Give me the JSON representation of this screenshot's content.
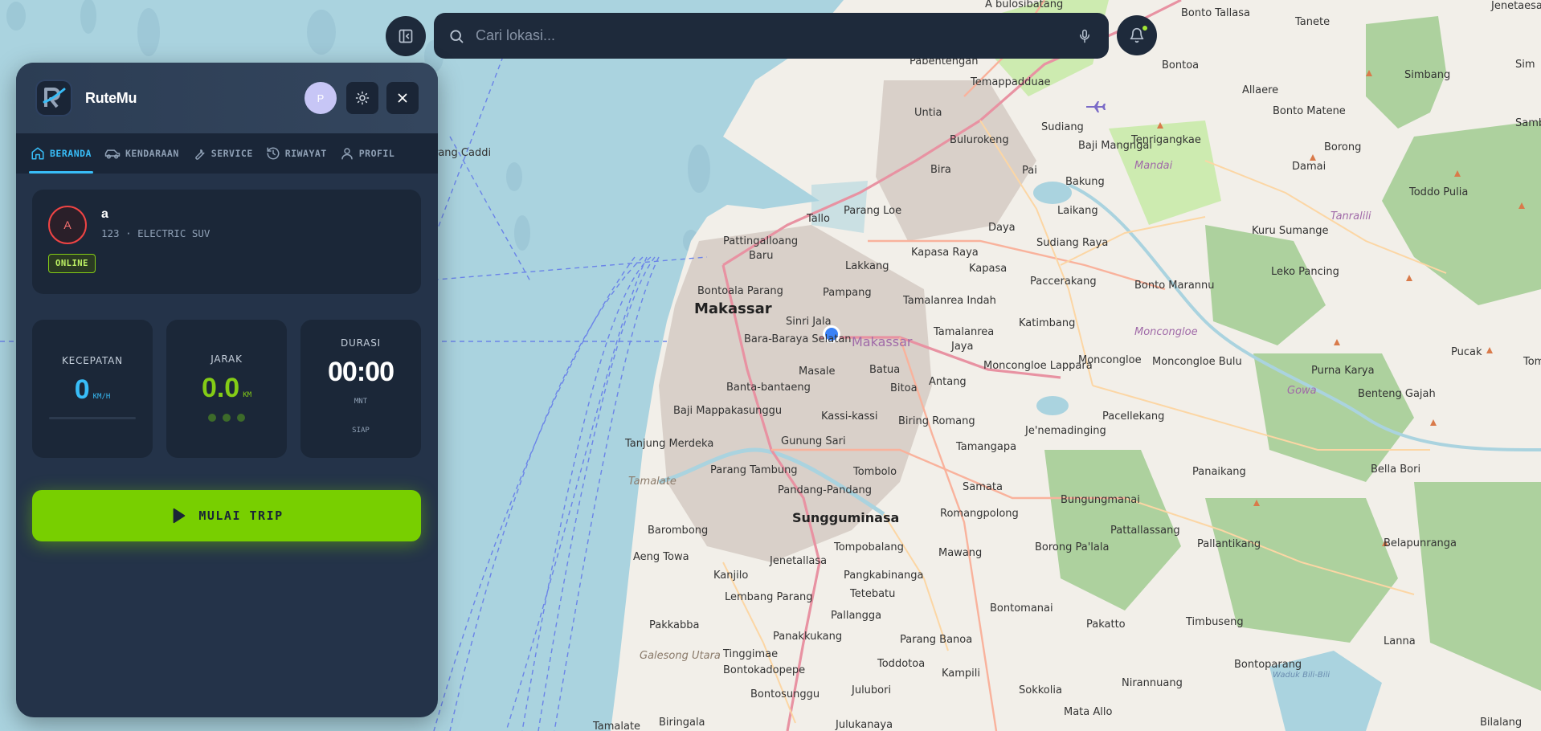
{
  "search": {
    "placeholder": "Cari lokasi..."
  },
  "app": {
    "name": "RuteMu",
    "user_initial": "P"
  },
  "tabs": [
    {
      "label": "BERANDA",
      "icon": "home-icon",
      "active": true
    },
    {
      "label": "KENDARAAN",
      "icon": "car-icon",
      "active": false
    },
    {
      "label": "SERVICE",
      "icon": "wrench-icon",
      "active": false
    },
    {
      "label": "RIWAYAT",
      "icon": "history-icon",
      "active": false
    },
    {
      "label": "PROFIL",
      "icon": "user-icon",
      "active": false
    }
  ],
  "vehicle": {
    "initial": "A",
    "name": "a",
    "subtitle": "123 · ELECTRIC SUV",
    "status": "ONLINE"
  },
  "stats": {
    "speed": {
      "title": "KECEPATAN",
      "value": "0",
      "unit": "KM/H"
    },
    "distance": {
      "title": "JARAK",
      "value": "0.0",
      "unit": "KM"
    },
    "duration": {
      "title": "DURASI",
      "value": "00:00",
      "unit": "MNT",
      "status": "SIAP"
    }
  },
  "start_button": {
    "label": "MULAI TRIP"
  },
  "colors": {
    "accent_blue": "#38bdf8",
    "accent_green": "#78cf00",
    "panel": "#243349",
    "danger": "#ef4444"
  },
  "map": {
    "labels": {
      "makassar_big": "Makassar",
      "makassar_area": "Makassar",
      "sungguminasa": "Sungguminasa",
      "untia": "Untia",
      "bira": "Bira",
      "bulurokeng": "Bulurokeng",
      "sudiang": "Sudiang",
      "sudiang_raya": "Sudiang Raya",
      "baji_mangngai": "Baji Mangngai",
      "bakung": "Bakung",
      "laikang": "Laikang",
      "daya": "Daya",
      "pai": "Pai",
      "tallo": "Tallo",
      "parang_loe": "Parang Loe",
      "pattingalloang": "Pattingalloang",
      "baru": "Baru",
      "lakkang": "Lakkang",
      "kapasa_raya": "Kapasa Raya",
      "kapasa": "Kapasa",
      "paccerakang": "Paccerakang",
      "bontoala_parang": "Bontoala Parang",
      "pampang": "Pampang",
      "tamalanrea_indah": "Tamalanrea Indah",
      "tamalanrea": "Tamalanrea",
      "tamalanrea_jaya": "Jaya",
      "katimbang": "Katimbang",
      "sinri_jala": "Sinri Jala",
      "bara_baraya": "Bara-Baraya Selatan",
      "masale": "Masale",
      "batua": "Batua",
      "bitoa": "Bitoa",
      "antang": "Antang",
      "moncongloe_lappara": "Moncongloe Lappara",
      "moncongloe": "Moncongloe",
      "banta_bantaeng": "Banta-bantaeng",
      "baji_mappakasunggu": "Baji Mappakasunggu",
      "kassi_kassi": "Kassi-kassi",
      "biring_romang": "Biring Romang",
      "tanjung_merdeka": "Tanjung Merdeka",
      "gunung_sari": "Gunung Sari",
      "tamangapa": "Tamangapa",
      "jenemadinging": "Je'nemadinging",
      "parang_tambung": "Parang Tambung",
      "tombolo": "Tombolo",
      "pandang": "Pandang-Pandang",
      "samata": "Samata",
      "romangpolong": "Romangpolong",
      "barombong": "Barombong",
      "tompobalang": "Tompobalang",
      "mawang": "Mawang",
      "aeng_towa": "Aeng Towa",
      "jenetallasa": "Jenetallasa",
      "kanjilo": "Kanjilo",
      "pangkabinanga": "Pangkabinanga",
      "lembang_parang": "Lembang Parang",
      "tetebatu": "Tetebatu",
      "pallangga": "Pallangga",
      "pakkabba": "Pakkabba",
      "panakkukang": "Panakkukang",
      "parang_banoa": "Parang Banoa",
      "tinggimae": "Tinggimae",
      "toddotoa": "Toddotoa",
      "bontokadopepe": "Bontokadopepe",
      "kampili": "Kampili",
      "julubori": "Julubori",
      "bontosunggu": "Bontosunggu",
      "sokkolia": "Sokkolia",
      "mata_allo": "Mata Allo",
      "biringala": "Biringala",
      "julukanaya": "Julukanaya",
      "tamalate": "Tamalate",
      "galesong_utara": "Galesong Utara",
      "tamalate_water": "Tamalate",
      "pabentengan": "Pabentengan",
      "temappadduae": "Temappadduae",
      "bontoa": "Bontoa",
      "bonto_tallasa": "Bonto Tallasa",
      "tanete": "Tanete",
      "jenetaesa": "Jenetaesa",
      "a_bulosibatang": "A bulosibatang",
      "allaere": "Allaere",
      "bonto_matene": "Bonto Matene",
      "simbang": "Simbang",
      "tenrigangkae": "Tenrigangkae",
      "mandai": "Mandai",
      "borong": "Borong",
      "damai": "Damai",
      "toddo_pulia": "Toddo Pulia",
      "tanralili": "Tanralili",
      "kuru_sumange": "Kuru Sumange",
      "leko_pancing": "Leko Pancing",
      "bonto_marannu": "Bonto Marannu",
      "moncongloe_purple": "Moncongloe",
      "moncongloe_bulu": "Moncongloe Bulu",
      "pucak": "Pucak",
      "purna_karya": "Purna Karya",
      "gowa": "Gowa",
      "benteng_gajah": "Benteng Gajah",
      "pacellekang": "Pacellekang",
      "panaikang": "Panaikang",
      "bella_bori": "Bella Bori",
      "bungungmanai": "Bungungmanai",
      "pattallassang": "Pattallassang",
      "borong_pallala": "Borong Pa'lala",
      "pallantikang": "Pallantikang",
      "belapunranga": "Belapunranga",
      "bontomanai": "Bontomanai",
      "pakatto": "Pakatto",
      "timbuseng": "Timbuseng",
      "lanna": "Lanna",
      "bontoparang": "Bontoparang",
      "nirannuang": "Nirannuang",
      "waduk": "Waduk Bili-Bili",
      "bilalang": "Bilalang",
      "gang_caddi": "rang Caddi",
      "samb": "Samb",
      "tom": "Tom",
      "sim": "Sim"
    }
  }
}
